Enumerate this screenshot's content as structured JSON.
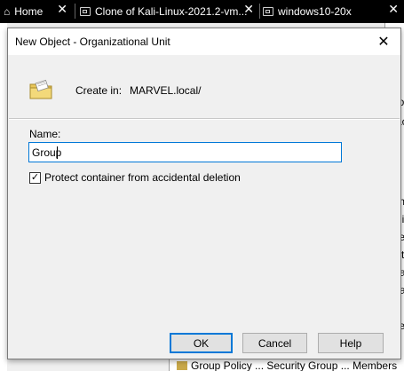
{
  "vm_tabs": [
    {
      "label": "Home",
      "icon": "home-icon"
    },
    {
      "label": "Clone of Kali-Linux-2021.2-vm...",
      "icon": "vm-icon"
    },
    {
      "label": "windows10-20x",
      "icon": "vm-icon"
    }
  ],
  "tab_close_glyph": "✕",
  "background": {
    "right_fragments": [
      "io",
      "ac",
      "s i",
      "s c",
      "s c",
      "s c",
      "mi",
      "ni",
      "ted",
      "sta",
      "rai",
      "rai",
      "s",
      "ted",
      "s c",
      "s c"
    ],
    "bottom_text": "Group Policy ... Security Group ... Members"
  },
  "dialog": {
    "title": "New Object - Organizational Unit",
    "close_glyph": "✕",
    "create_in_label": "Create in:",
    "create_in_value": "MARVEL.local/",
    "name_label": "Name:",
    "name_value": "Group",
    "protect_label": "Protect container from accidental deletion",
    "protect_checked": true,
    "check_glyph": "✓",
    "buttons": {
      "ok": "OK",
      "cancel": "Cancel",
      "help": "Help"
    }
  },
  "colors": {
    "accent": "#0078d7",
    "dialog_bg": "#f0f0f0",
    "tabbar_bg": "#000000",
    "folder_yellow": "#e8c65a"
  }
}
